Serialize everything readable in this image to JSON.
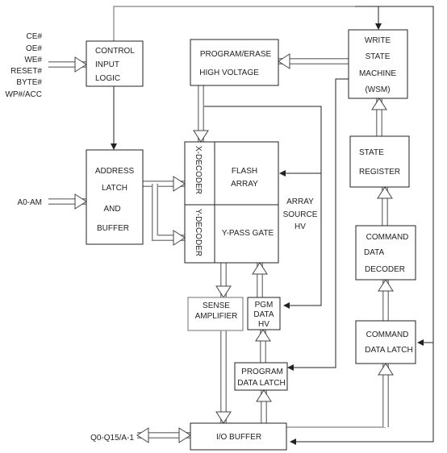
{
  "signals": [
    "CE#",
    "OE#",
    "WE#",
    "RESET#",
    "BYTE#",
    "WP#/ACC"
  ],
  "address_input": "A0-AM",
  "data_io": "Q0-Q15/A-1",
  "blocks": {
    "control": [
      "CONTROL",
      "INPUT",
      "LOGIC"
    ],
    "address": [
      "ADDRESS",
      "LATCH",
      "AND",
      "BUFFER"
    ],
    "program_erase": [
      "PROGRAM/ERASE",
      "HIGH VOLTAGE"
    ],
    "wsm": [
      "WRITE",
      "STATE",
      "MACHINE",
      "(WSM)"
    ],
    "x_decoder": "X-DECODER",
    "y_decoder": "Y-DECODER",
    "flash_array": [
      "FLASH",
      "ARRAY"
    ],
    "y_pass_gate": "Y-PASS GATE",
    "array_source": [
      "ARRAY",
      "SOURCE",
      "HV"
    ],
    "state_register": [
      "STATE",
      "REGISTER"
    ],
    "command_decoder": [
      "COMMAND",
      "DATA",
      "DECODER"
    ],
    "command_latch": [
      "COMMAND",
      "DATA LATCH"
    ],
    "sense_amp": [
      "SENSE",
      "AMPLIFIER"
    ],
    "pgm_data_hv": [
      "PGM",
      "DATA",
      "HV"
    ],
    "program_latch": [
      "PROGRAM",
      "DATA LATCH"
    ],
    "io_buffer": "I/O BUFFER"
  }
}
